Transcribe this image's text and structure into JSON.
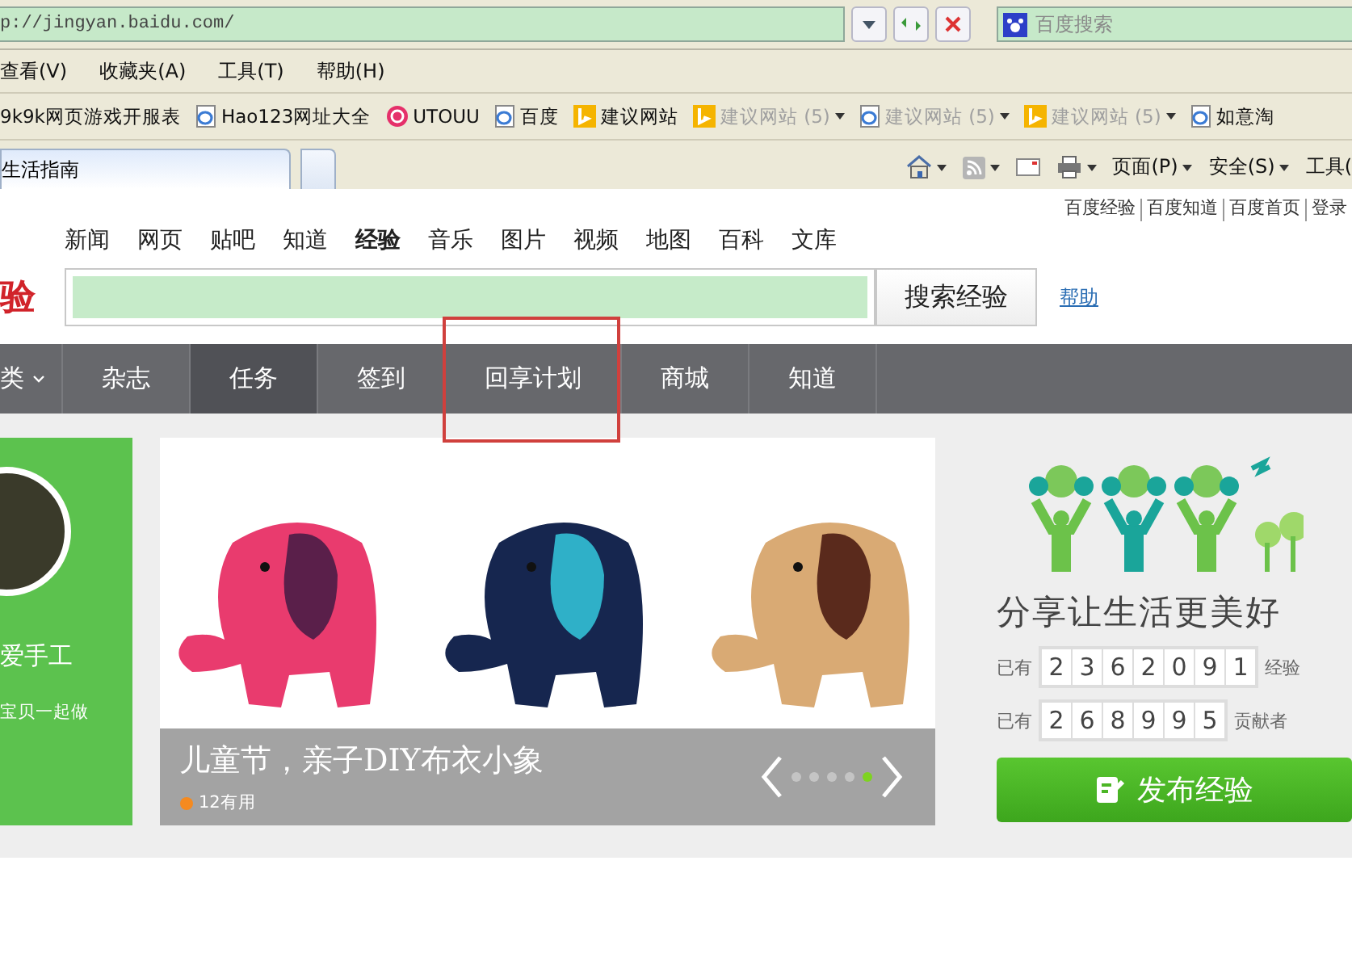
{
  "browser": {
    "address": "p://jingyan.baidu.com/",
    "search_placeholder": "百度搜索",
    "menu": [
      "查看(V)",
      "收藏夹(A)",
      "工具(T)",
      "帮助(H)"
    ],
    "favorites": [
      {
        "label": "9k9k网页游戏开服表",
        "kind": "plain",
        "disabled": false,
        "dropdown": false
      },
      {
        "label": "Hao123网址大全",
        "kind": "ie",
        "disabled": false,
        "dropdown": false
      },
      {
        "label": "UTOUU",
        "kind": "swirl",
        "disabled": false,
        "dropdown": false
      },
      {
        "label": "百度",
        "kind": "ie",
        "disabled": false,
        "dropdown": false
      },
      {
        "label": "建议网站",
        "kind": "bing",
        "disabled": false,
        "dropdown": false
      },
      {
        "label": "建议网站 (5)",
        "kind": "bing",
        "disabled": true,
        "dropdown": true
      },
      {
        "label": "建议网站 (5)",
        "kind": "ie",
        "disabled": true,
        "dropdown": true
      },
      {
        "label": "建议网站 (5)",
        "kind": "bing",
        "disabled": true,
        "dropdown": true
      },
      {
        "label": "如意淘",
        "kind": "ie",
        "disabled": false,
        "dropdown": false
      }
    ],
    "tabs": [
      {
        "title": "生活指南",
        "selected": true
      },
      {
        "selected": false
      }
    ],
    "commands": [
      {
        "kind": "home",
        "dropdown": true
      },
      {
        "kind": "rss",
        "dropdown": true
      },
      {
        "kind": "mail",
        "dropdown": false
      },
      {
        "kind": "print",
        "dropdown": true
      },
      {
        "kind": "text",
        "label": "页面(P)",
        "dropdown": true
      },
      {
        "kind": "text",
        "label": "安全(S)",
        "dropdown": true
      },
      {
        "kind": "text",
        "label": "工具(",
        "dropdown": false
      }
    ]
  },
  "page": {
    "top_links": [
      "百度经验",
      "百度知道",
      "百度首页",
      "登录"
    ],
    "channels": [
      {
        "label": "新闻",
        "selected": false
      },
      {
        "label": "网页",
        "selected": false
      },
      {
        "label": "贴吧",
        "selected": false
      },
      {
        "label": "知道",
        "selected": false
      },
      {
        "label": "经验",
        "selected": true
      },
      {
        "label": "音乐",
        "selected": false
      },
      {
        "label": "图片",
        "selected": false
      },
      {
        "label": "视频",
        "selected": false
      },
      {
        "label": "地图",
        "selected": false
      },
      {
        "label": "百科",
        "selected": false
      },
      {
        "label": "文库",
        "selected": false
      }
    ],
    "logo": "验",
    "search_button": "搜索经验",
    "help_link": "帮助",
    "nav": [
      {
        "label": "类",
        "selected": false,
        "dropdown": true,
        "highlighted": false
      },
      {
        "label": "杂志",
        "selected": false,
        "dropdown": false,
        "highlighted": false
      },
      {
        "label": "任务",
        "selected": true,
        "dropdown": false,
        "highlighted": false
      },
      {
        "label": "签到",
        "selected": false,
        "dropdown": false,
        "highlighted": false
      },
      {
        "label": "回享计划",
        "selected": false,
        "dropdown": false,
        "highlighted": true
      },
      {
        "label": "商城",
        "selected": false,
        "dropdown": false,
        "highlighted": false
      },
      {
        "label": "知道",
        "selected": false,
        "dropdown": false,
        "highlighted": false
      }
    ],
    "banner": {
      "author": "爱手工",
      "author_note": "宝贝一起做",
      "title": "儿童节，亲子DIY布衣小象",
      "useful": "12有用",
      "dots": [
        {
          "selected": false
        },
        {
          "selected": false
        },
        {
          "selected": false
        },
        {
          "selected": false
        },
        {
          "selected": true
        }
      ]
    },
    "side": {
      "slogan": "分享让生活更美好",
      "stats": [
        {
          "prefix": "已有",
          "digits": [
            "2",
            "3",
            "6",
            "2",
            "0",
            "9",
            "1"
          ],
          "suffix": "经验"
        },
        {
          "prefix": "已有",
          "digits": [
            "2",
            "6",
            "8",
            "9",
            "9",
            "5"
          ],
          "suffix": "贡献者"
        }
      ],
      "publish_button": "发布经验"
    }
  }
}
